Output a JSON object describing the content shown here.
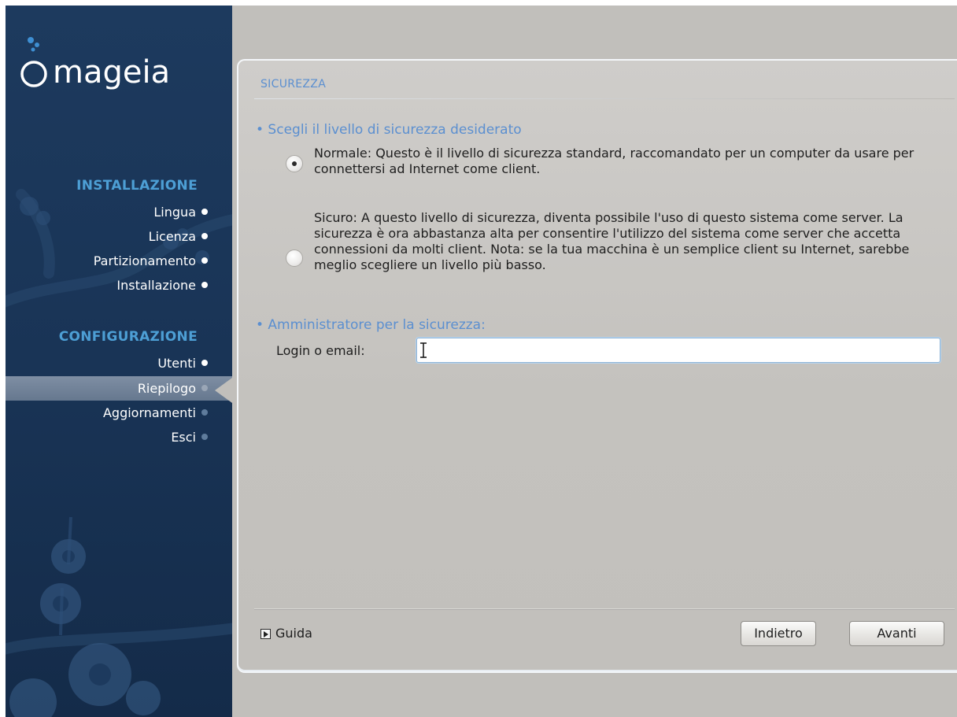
{
  "brand": {
    "name": "mageia"
  },
  "sidebar": {
    "sections": [
      {
        "heading": "INSTALLAZIONE",
        "items": [
          {
            "label": "Lingua",
            "state": "done"
          },
          {
            "label": "Licenza",
            "state": "done"
          },
          {
            "label": "Partizionamento",
            "state": "done"
          },
          {
            "label": "Installazione",
            "state": "done"
          }
        ]
      },
      {
        "heading": "CONFIGURAZIONE",
        "items": [
          {
            "label": "Utenti",
            "state": "done"
          },
          {
            "label": "Riepilogo",
            "state": "active"
          },
          {
            "label": "Aggiornamenti",
            "state": "pending"
          },
          {
            "label": "Esci",
            "state": "pending"
          }
        ]
      }
    ]
  },
  "panel": {
    "title": "SICUREZZA",
    "security_level": {
      "label": "• Scegli il livello di sicurezza desiderato",
      "options": [
        {
          "text": "Normale: Questo è il livello di sicurezza standard, raccomandato per un computer da usare per connettersi ad Internet come client.",
          "checked": true
        },
        {
          "text": "Sicuro: A questo livello di sicurezza, diventa possibile l'uso di questo sistema come server. La sicurezza è ora abbastanza alta per consentire l'utilizzo del sistema come server che accetta connessioni da molti client. Nota: se la tua macchina è un semplice client su Internet, sarebbe meglio scegliere un livello più basso.",
          "checked": false
        }
      ]
    },
    "admin": {
      "label": "• Amministratore per la sicurezza:",
      "login_label": "Login o email:",
      "login_value": ""
    },
    "footer": {
      "help_label": "Guida",
      "back_label": "Indietro",
      "next_label": "Avanti"
    }
  },
  "colors": {
    "sidebar_bg": "#1d3a5e",
    "heading_blue": "#4d9fd5",
    "title_blue": "#5b8fd0",
    "panel_bg": "#c8c6c2"
  }
}
